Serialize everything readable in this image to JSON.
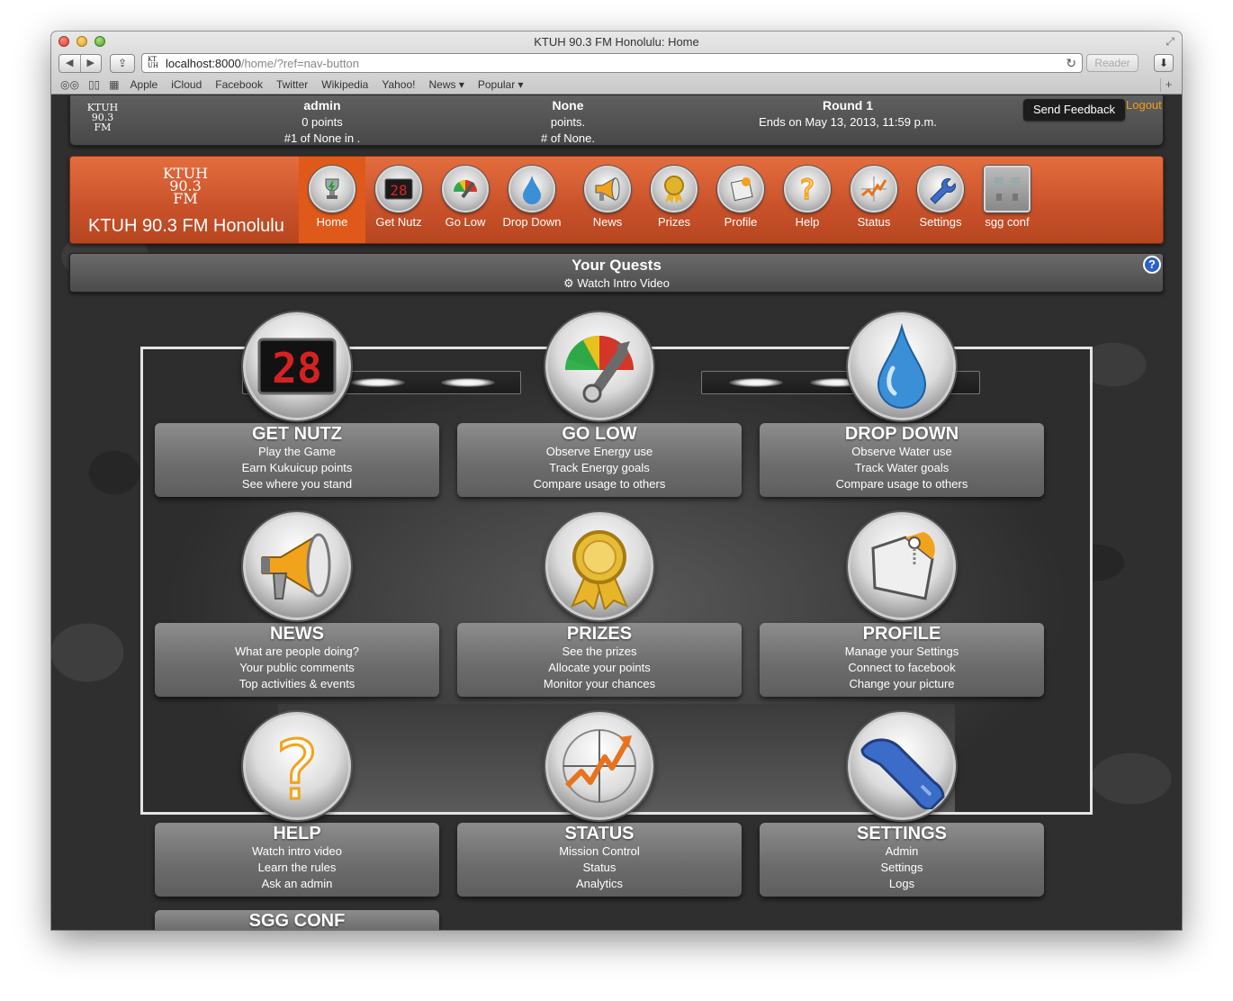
{
  "browser": {
    "title": "KTUH 90.3 FM Honolulu: Home",
    "url_host": "localhost:8000",
    "url_path": "/home/?ref=nav-button",
    "reader_label": "Reader",
    "bookmarks": [
      "Apple",
      "iCloud",
      "Facebook",
      "Twitter",
      "Wikipedia",
      "Yahoo!",
      "News ▾",
      "Popular ▾"
    ]
  },
  "topbar": {
    "logo_text": [
      "KTUH",
      "90.3",
      "FM"
    ],
    "user": {
      "name": "admin",
      "points": "0 points",
      "rank": "#1 of None in ."
    },
    "team": {
      "name": "None",
      "points": "points.",
      "rank": "# of None."
    },
    "round": {
      "name": "Round 1",
      "ends": "Ends on May 13, 2013, 11:59 p.m."
    },
    "feedback_label": "Send Feedback",
    "logout_label": "Logout"
  },
  "header": {
    "logo_text": [
      "KTUH",
      "90.3",
      "FM"
    ],
    "site_name": "KTUH 90.3 FM Honolulu",
    "nav": [
      {
        "label": "Home",
        "icon": "trophy-icon"
      },
      {
        "label": "Get Nutz",
        "icon": "scoreboard-icon"
      },
      {
        "label": "Go Low",
        "icon": "gauge-icon"
      },
      {
        "label": "Drop Down",
        "icon": "water-drop-icon"
      },
      {
        "label": "News",
        "icon": "megaphone-icon"
      },
      {
        "label": "Prizes",
        "icon": "medal-icon"
      },
      {
        "label": "Profile",
        "icon": "tag-icon"
      },
      {
        "label": "Help",
        "icon": "question-icon"
      },
      {
        "label": "Status",
        "icon": "chart-icon"
      },
      {
        "label": "Settings",
        "icon": "wrench-icon"
      },
      {
        "label": "sgg conf",
        "icon": "trophies-icon"
      }
    ]
  },
  "quests": {
    "title": "Your Quests",
    "subtitle": "Watch Intro Video",
    "help_badge": "?"
  },
  "tiles": [
    {
      "title": "GET NUTZ",
      "lines": [
        "Play the Game",
        "Earn Kukuicup points",
        "See where you stand"
      ],
      "icon": "scoreboard-icon",
      "scoreboard": "28"
    },
    {
      "title": "GO LOW",
      "lines": [
        "Observe Energy use",
        "Track Energy goals",
        "Compare usage to others"
      ],
      "icon": "gauge-icon"
    },
    {
      "title": "DROP DOWN",
      "lines": [
        "Observe Water use",
        "Track Water goals",
        "Compare usage to others"
      ],
      "icon": "water-drop-icon"
    },
    {
      "title": "NEWS",
      "lines": [
        "What are people doing?",
        "Your public comments",
        "Top activities & events"
      ],
      "icon": "megaphone-icon"
    },
    {
      "title": "PRIZES",
      "lines": [
        "See the prizes",
        "Allocate your points",
        "Monitor your chances"
      ],
      "icon": "medal-icon"
    },
    {
      "title": "PROFILE",
      "lines": [
        "Manage your Settings",
        "Connect to facebook",
        "Change your picture"
      ],
      "icon": "tag-icon"
    },
    {
      "title": "HELP",
      "lines": [
        "Watch intro video",
        "Learn the rules",
        "Ask an admin"
      ],
      "icon": "question-icon"
    },
    {
      "title": "STATUS",
      "lines": [
        "Mission Control",
        "Status",
        "Analytics"
      ],
      "icon": "chart-icon"
    },
    {
      "title": "SETTINGS",
      "lines": [
        "Admin",
        "Settings",
        "Logs"
      ],
      "icon": "wrench-icon"
    },
    {
      "title": "SGG CONF",
      "lines": [],
      "icon": ""
    }
  ],
  "colors": {
    "accent_orange": "#d9572a",
    "logout": "#f29b1c",
    "help_blue": "#2e61c8"
  }
}
